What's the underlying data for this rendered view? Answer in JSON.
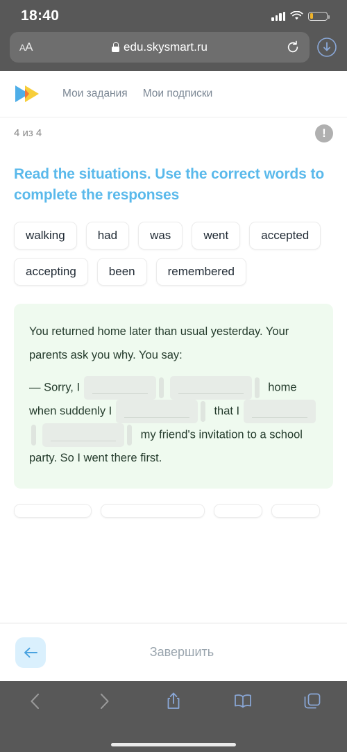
{
  "browser": {
    "status": {
      "time": "18:40",
      "cellular_icon": "cellular-bars-icon",
      "wifi_icon": "wifi-icon",
      "battery_icon": "battery-low-icon",
      "battery_color": "#f0b429"
    },
    "address_bar": {
      "text_size_label": "AA",
      "lock_icon": "lock-icon",
      "url": "edu.skysmart.ru",
      "reload_icon": "reload-icon",
      "downloads_icon": "downloads-icon"
    },
    "toolbar": {
      "back_icon": "chevron-left-icon",
      "forward_icon": "chevron-right-icon",
      "share_icon": "share-icon",
      "bookmarks_icon": "book-icon",
      "tabs_icon": "tabs-icon",
      "accent_color": "#8aa8d8",
      "disabled_color": "#9a9a9a"
    }
  },
  "site": {
    "logo_icon": "skysmart-logo-icon",
    "logo_colors": {
      "blue": "#4eaee8",
      "yellow": "#f7cb2f",
      "orange": "#f26b3a"
    },
    "nav": [
      {
        "label": "Мои задания"
      },
      {
        "label": "Мои подписки"
      }
    ],
    "progress": {
      "label": "4 из 4",
      "warning_icon": "exclamation-circle-icon",
      "warning_glyph": "!"
    }
  },
  "task": {
    "title": "Read the situations. Use the correct words to complete the responses",
    "title_color": "#5ab9eb",
    "word_bank": [
      "walking",
      "had",
      "was",
      "went",
      "accepted",
      "accepting",
      "been",
      "remembered"
    ],
    "card": {
      "background_color": "#effaef",
      "prompt": "You returned home later than usual yesterday. Your parents ask you why. You say:",
      "answer_parts": {
        "lead": "— Sorry, I",
        "mid1": "home when suddenly I",
        "mid2": "that I",
        "mid3": "my friend's",
        "tail": "invitation to a school party. So I went there first."
      },
      "blank_slots": [
        {
          "id": "slot-1",
          "value": ""
        },
        {
          "id": "slot-2",
          "value": ""
        },
        {
          "id": "slot-3",
          "value": ""
        },
        {
          "id": "slot-4",
          "value": ""
        },
        {
          "id": "slot-5",
          "value": ""
        }
      ]
    },
    "next_chips_partial": [
      "",
      "",
      "",
      ""
    ]
  },
  "actions": {
    "back_icon": "arrow-left-icon",
    "back_color": "#4aa3e0",
    "finish_label": "Завершить"
  }
}
